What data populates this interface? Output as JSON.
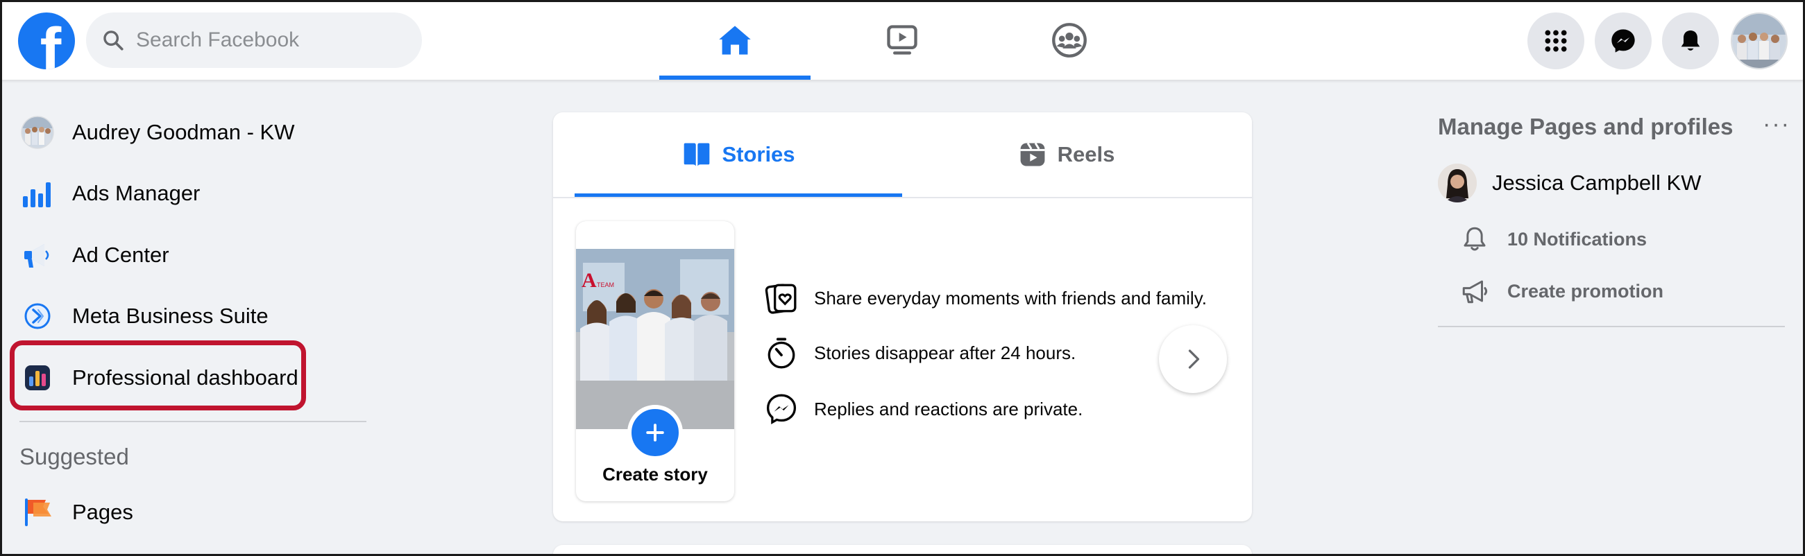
{
  "brand": {
    "logo_glyph": "f",
    "color": "#1877f2"
  },
  "search": {
    "placeholder": "Search Facebook"
  },
  "nav": [
    {
      "name": "home",
      "active": true
    },
    {
      "name": "watch",
      "active": false
    },
    {
      "name": "groups",
      "active": false
    }
  ],
  "sidebar": {
    "items": [
      {
        "label": "Audrey Goodman - KW",
        "icon": "profile-avatar"
      },
      {
        "label": "Ads Manager",
        "icon": "bar-chart-icon"
      },
      {
        "label": "Ad Center",
        "icon": "megaphone-icon"
      },
      {
        "label": "Meta Business Suite",
        "icon": "business-suite-icon"
      },
      {
        "label": "Professional dashboard",
        "icon": "dashboard-icon",
        "highlighted": true
      }
    ],
    "suggested_heading": "Suggested",
    "suggested_items": [
      {
        "label": "Pages",
        "icon": "flag-icon"
      }
    ]
  },
  "stories_card": {
    "tabs": [
      {
        "label": "Stories",
        "active": true
      },
      {
        "label": "Reels",
        "active": false
      }
    ],
    "create_story_label": "Create story",
    "photo_banner": "A TEAM",
    "info": [
      {
        "text": "Share everyday moments with friends and family.",
        "icon": "photo-heart-icon"
      },
      {
        "text": "Stories disappear after 24 hours.",
        "icon": "stopwatch-icon"
      },
      {
        "text": "Replies and reactions are private.",
        "icon": "messenger-icon"
      }
    ]
  },
  "right": {
    "title": "Manage Pages and profiles",
    "more": "···",
    "profile_name": "Jessica Campbell KW",
    "sub_items": [
      {
        "label": "10 Notifications",
        "icon": "bell-icon"
      },
      {
        "label": "Create promotion",
        "icon": "megaphone-icon"
      }
    ]
  },
  "colors": {
    "accent": "#1877f2",
    "highlight_border": "#c0142f",
    "background": "#f0f2f5"
  }
}
